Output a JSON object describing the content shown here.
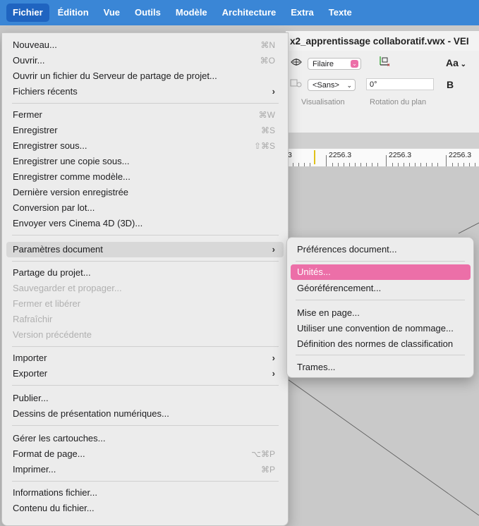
{
  "menubar": {
    "items": [
      "Fichier",
      "Édition",
      "Vue",
      "Outils",
      "Modèle",
      "Architecture",
      "Extra",
      "Texte"
    ],
    "active_index": 0,
    "background": "#3a86d6",
    "active_background": "#1f64c0"
  },
  "window": {
    "title": "x2_apprentissage collaboratif.vwx - VEI"
  },
  "toolbar": {
    "render_mode": "Filaire",
    "class_select": "<Sans>",
    "rotation_value": "0°",
    "visualisation_caption": "Visualisation",
    "rotation_caption": "Rotation du plan",
    "font_button": "Aa",
    "bold_button": "B"
  },
  "ruler": {
    "labels": [
      "3",
      "2256.3",
      "2256.3",
      "2256.3"
    ]
  },
  "menu": {
    "items": [
      {
        "label": "Nouveau...",
        "shortcut": "⌘N"
      },
      {
        "label": "Ouvrir...",
        "shortcut": "⌘O"
      },
      {
        "label": "Ouvrir un fichier du Serveur de partage de projet...",
        "shortcut": ""
      },
      {
        "label": "Fichiers récents",
        "submenu": true
      },
      {
        "label": "Fermer",
        "shortcut": "⌘W"
      },
      {
        "label": "Enregistrer",
        "shortcut": "⌘S"
      },
      {
        "label": "Enregistrer sous...",
        "shortcut": "⇧⌘S"
      },
      {
        "label": "Enregistrer une copie sous...",
        "shortcut": ""
      },
      {
        "label": "Enregistrer comme modèle...",
        "shortcut": ""
      },
      {
        "label": "Dernière version enregistrée",
        "shortcut": ""
      },
      {
        "label": "Conversion par lot...",
        "shortcut": ""
      },
      {
        "label": "Envoyer vers Cinema 4D (3D)...",
        "shortcut": ""
      },
      {
        "label": "Paramètres document",
        "submenu": true,
        "highlight": true
      },
      {
        "label": "Partage du projet...",
        "shortcut": ""
      },
      {
        "label": "Sauvegarder et propager...",
        "disabled": true
      },
      {
        "label": "Fermer et libérer",
        "disabled": true
      },
      {
        "label": "Rafraîchir",
        "disabled": true
      },
      {
        "label": "Version précédente",
        "disabled": true
      },
      {
        "label": "Importer",
        "submenu": true
      },
      {
        "label": "Exporter",
        "submenu": true
      },
      {
        "label": "Publier...",
        "shortcut": ""
      },
      {
        "label": "Dessins de présentation numériques...",
        "shortcut": ""
      },
      {
        "label": "Gérer les cartouches...",
        "shortcut": ""
      },
      {
        "label": "Format de page...",
        "shortcut": "⌥⌘P"
      },
      {
        "label": "Imprimer...",
        "shortcut": "⌘P"
      },
      {
        "label": "Informations fichier...",
        "shortcut": ""
      },
      {
        "label": "Contenu du fichier...",
        "shortcut": ""
      }
    ]
  },
  "submenu": {
    "items": [
      {
        "label": "Préférences document..."
      },
      {
        "label": "Unités...",
        "selected": true
      },
      {
        "label": "Géoréférencement..."
      },
      {
        "label": "Mise en page..."
      },
      {
        "label": "Utiliser une convention de nommage..."
      },
      {
        "label": "Définition des normes de classification"
      },
      {
        "label": "Trames..."
      }
    ],
    "selection_color": "#ec6fa8"
  }
}
